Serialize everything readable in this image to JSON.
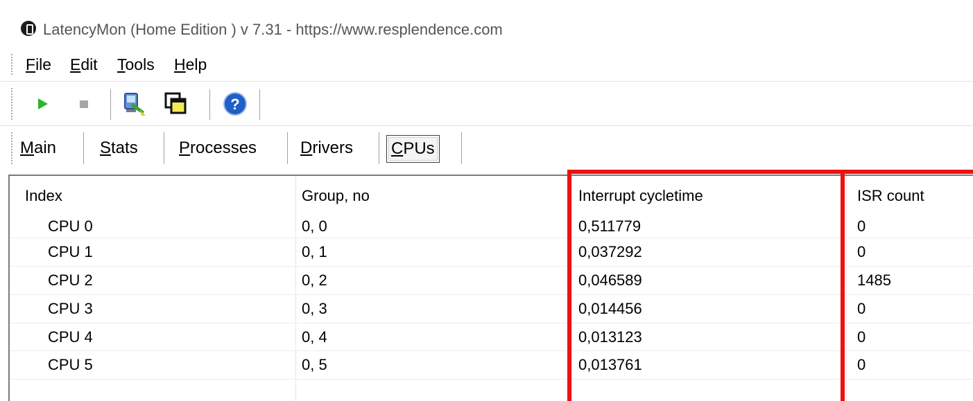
{
  "window": {
    "title": "LatencyMon  (Home Edition )  v 7.31 - https://www.resplendence.com"
  },
  "menu": [
    "File",
    "Edit",
    "Tools",
    "Help"
  ],
  "toolbar": {
    "buttons": [
      "play-icon",
      "stop-icon",
      "remote-computer-icon",
      "windows-icon",
      "help-icon"
    ]
  },
  "tabs": {
    "items": [
      "Main",
      "Stats",
      "Processes",
      "Drivers",
      "CPUs"
    ],
    "active": "CPUs"
  },
  "table": {
    "columns": [
      "Index",
      "Group, no",
      "Interrupt cycletime",
      "ISR count"
    ],
    "rows": [
      [
        "CPU 0",
        "0, 0",
        "0,511779",
        "0"
      ],
      [
        "CPU 1",
        "0, 1",
        "0,037292",
        "0"
      ],
      [
        "CPU 2",
        "0, 2",
        "0,046589",
        "1485"
      ],
      [
        "CPU 3",
        "0, 3",
        "0,014456",
        "0"
      ],
      [
        "CPU 4",
        "0, 4",
        "0,013123",
        "0"
      ],
      [
        "CPU 5",
        "0, 5",
        "0,013761",
        "0"
      ]
    ]
  },
  "colors": {
    "highlight": "#ee1111",
    "play": "#2bb52b",
    "stop": "#a6a6a6",
    "help": "#1f5fc8"
  }
}
